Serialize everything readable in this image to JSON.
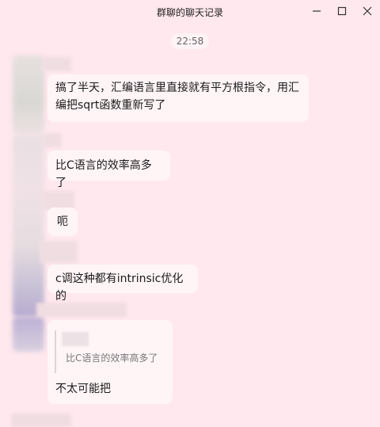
{
  "window": {
    "title": "群聊的聊天记录",
    "icons": [
      "minimize-icon",
      "maximize-icon",
      "close-icon"
    ]
  },
  "chat": {
    "timestamp": "22:58",
    "messages": [
      {
        "text": "搞了半天，汇编语言里直接就有平方根指令，用汇编把sqrt函数重新写了"
      },
      {
        "text": "比C语言的效率高多了"
      },
      {
        "text": "呃"
      },
      {
        "text": "c调这种都有intrinsic优化的"
      },
      {
        "quote": "比C语言的效率高多了",
        "text": "不太可能把"
      }
    ]
  }
}
